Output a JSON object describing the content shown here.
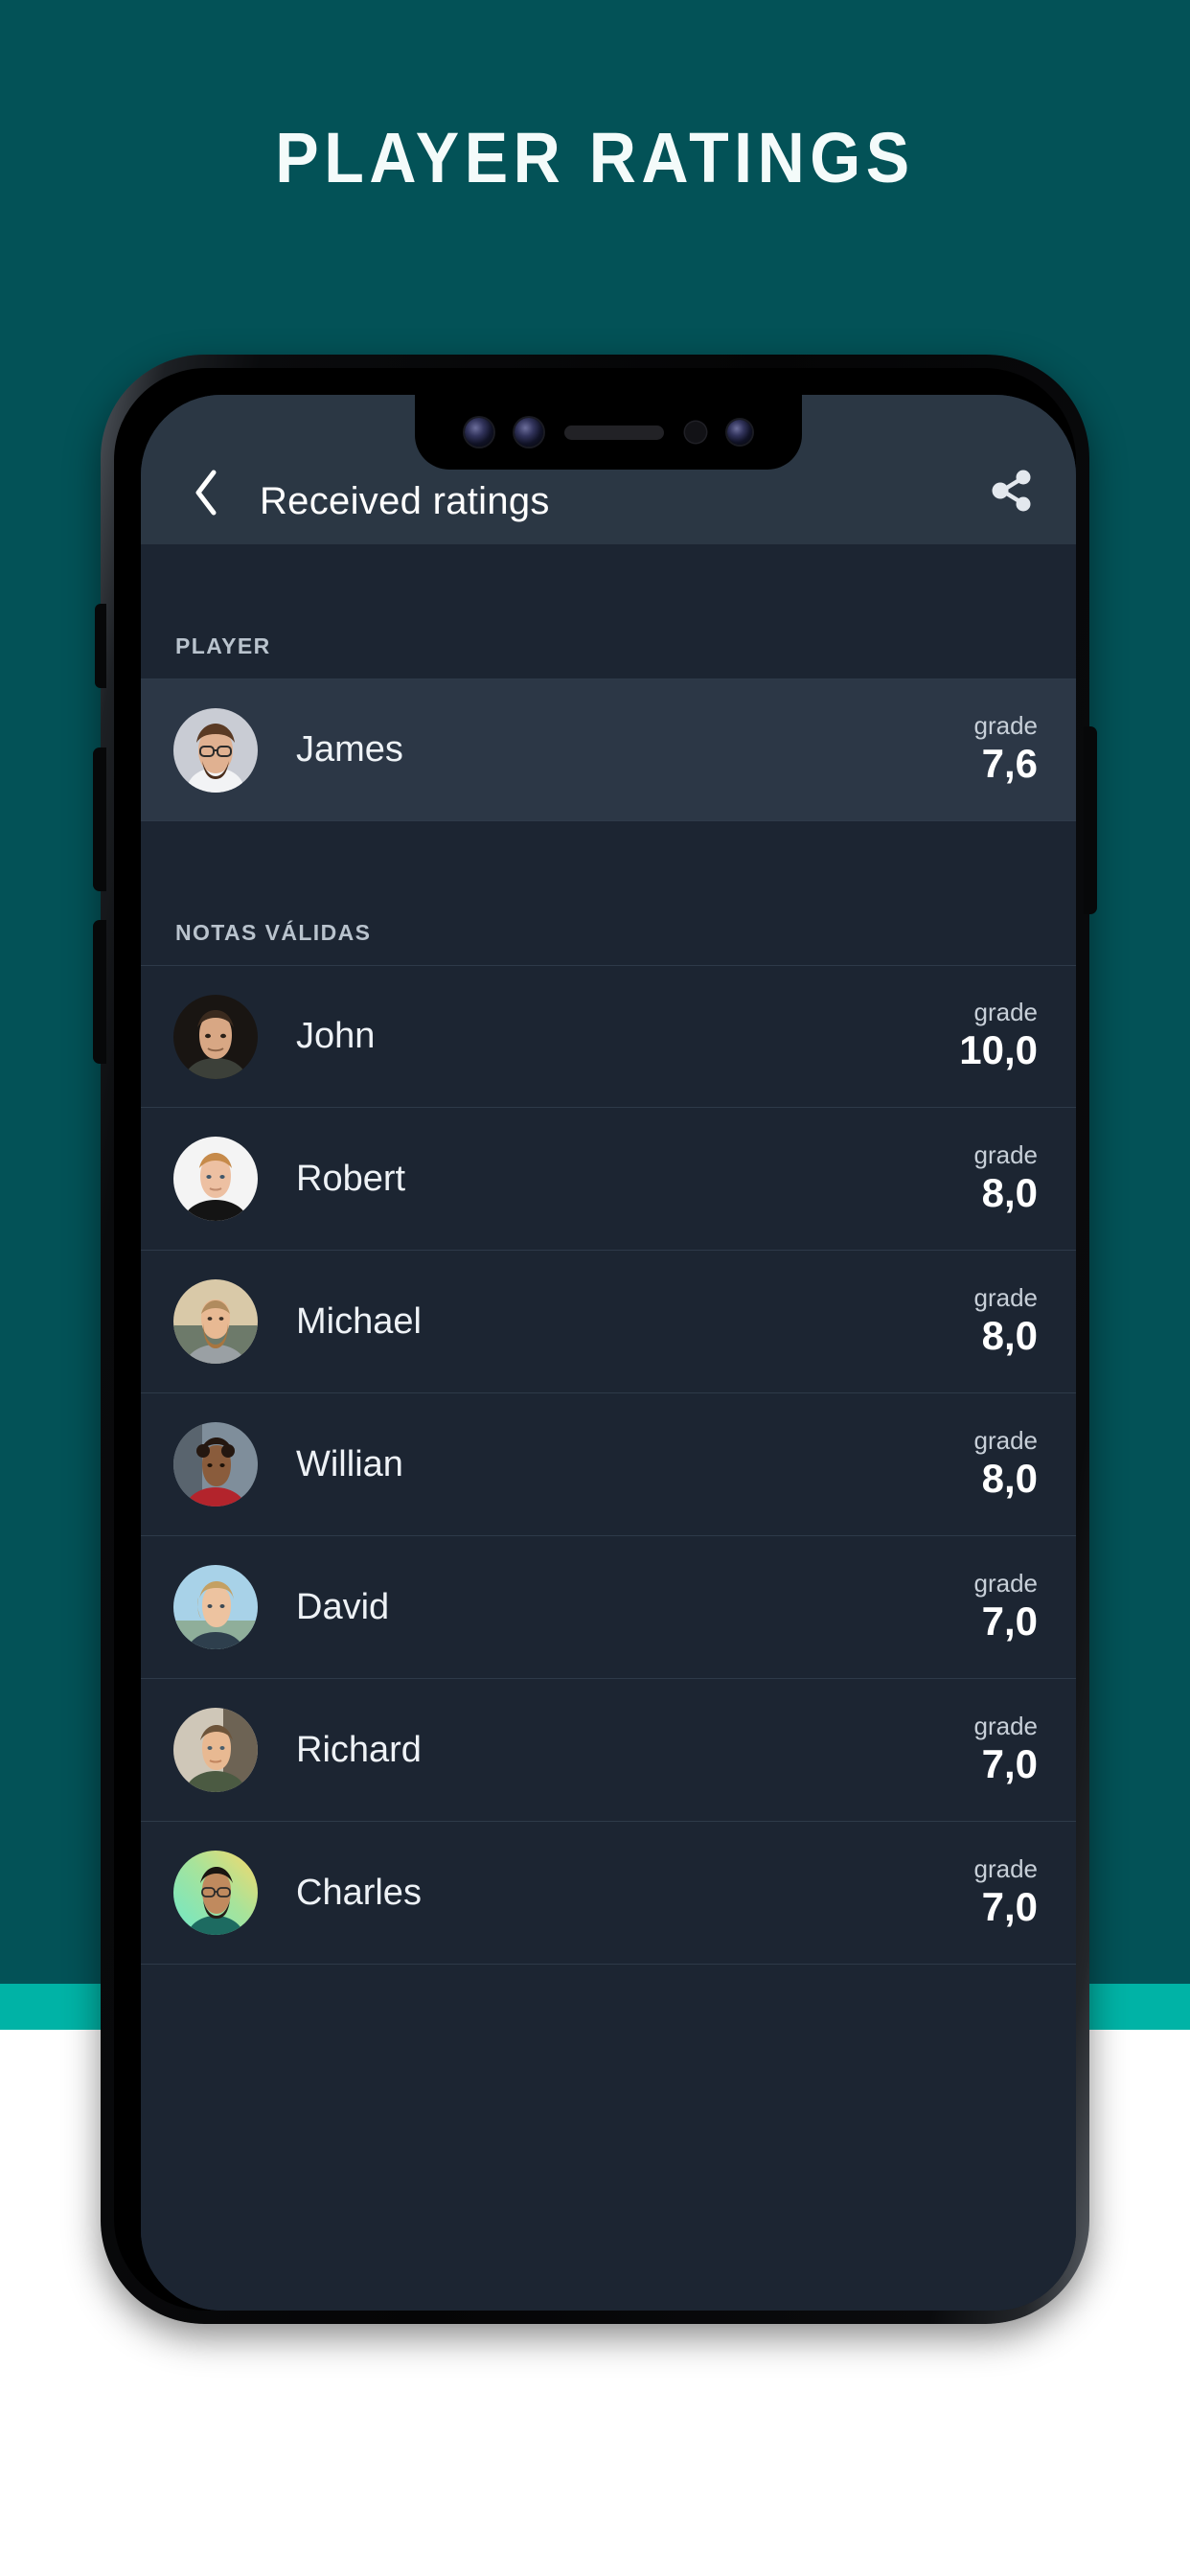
{
  "poster": {
    "title": "PLAYER  RATINGS",
    "background_color": "#035257",
    "accent_stripe_color": "#00b3a6",
    "base_color": "#ffffff"
  },
  "app": {
    "header": {
      "back_icon": "chevron-left-icon",
      "title": "Received ratings",
      "share_icon": "share-icon"
    },
    "sections": [
      {
        "label": "PLAYER",
        "rows": [
          {
            "name": "James",
            "grade_label": "grade",
            "grade": "7,6",
            "avatar": "avatar-james",
            "highlight": true
          }
        ]
      },
      {
        "label": "NOTAS VÁLIDAS",
        "rows": [
          {
            "name": "John",
            "grade_label": "grade",
            "grade": "10,0",
            "avatar": "avatar-john",
            "highlight": false
          },
          {
            "name": "Robert",
            "grade_label": "grade",
            "grade": "8,0",
            "avatar": "avatar-robert",
            "highlight": false
          },
          {
            "name": "Michael",
            "grade_label": "grade",
            "grade": "8,0",
            "avatar": "avatar-michael",
            "highlight": false
          },
          {
            "name": "Willian",
            "grade_label": "grade",
            "grade": "8,0",
            "avatar": "avatar-willian",
            "highlight": false
          },
          {
            "name": "David",
            "grade_label": "grade",
            "grade": "7,0",
            "avatar": "avatar-david",
            "highlight": false
          },
          {
            "name": "Richard",
            "grade_label": "grade",
            "grade": "7,0",
            "avatar": "avatar-richard",
            "highlight": false
          },
          {
            "name": "Charles",
            "grade_label": "grade",
            "grade": "7,0",
            "avatar": "avatar-charles",
            "highlight": false
          }
        ]
      }
    ],
    "colors": {
      "screen_background": "#1c2532",
      "header_background": "#2b3744",
      "row_highlight": "#2c3746",
      "divider": "#2e3a49",
      "text_primary": "#eef2f6",
      "text_secondary": "#c7cfd8"
    }
  },
  "device": {
    "notch_items": [
      "camera-lens-icon",
      "camera-lens-icon",
      "speaker-grille-icon",
      "proximity-sensor-icon",
      "camera-lens-icon"
    ],
    "side_buttons": [
      "silent-switch",
      "volume-up-button",
      "volume-down-button",
      "power-button"
    ]
  }
}
